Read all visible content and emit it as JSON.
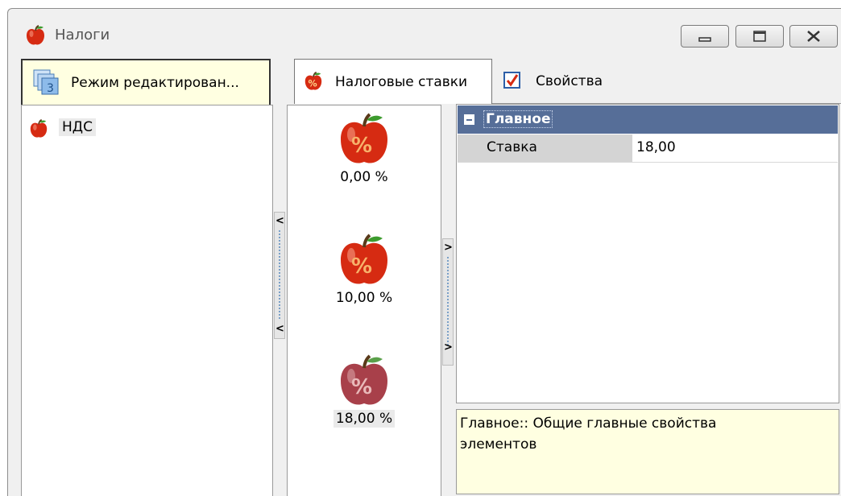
{
  "window": {
    "title": "Налоги",
    "icon": "apple-icon"
  },
  "mode_tab": {
    "label": "Режим редактирован...",
    "icon": "edit-mode-icon"
  },
  "tree": {
    "items": [
      {
        "label": "НДС",
        "icon": "apple-icon"
      }
    ]
  },
  "tabs": [
    {
      "label": "Налоговые ставки",
      "icon": "percent-apple-icon",
      "active": true
    },
    {
      "label": "Свойства",
      "icon": "checkbox-icon",
      "active": false
    }
  ],
  "rates": [
    {
      "label": "0,00 %",
      "icon": "percent-apple-icon"
    },
    {
      "label": "10,00 %",
      "icon": "percent-apple-icon"
    },
    {
      "label": "18,00 %",
      "icon": "percent-apple-icon",
      "selected": true
    }
  ],
  "properties": {
    "category": "Главное",
    "rows": [
      {
        "name": "Ставка",
        "value": "18,00"
      }
    ]
  },
  "description": "Главное:: Общие главные свойства элементов",
  "colors": {
    "category_header": "#566e98",
    "description_bg": "#ffffe1",
    "apple_red": "#d62b12"
  }
}
